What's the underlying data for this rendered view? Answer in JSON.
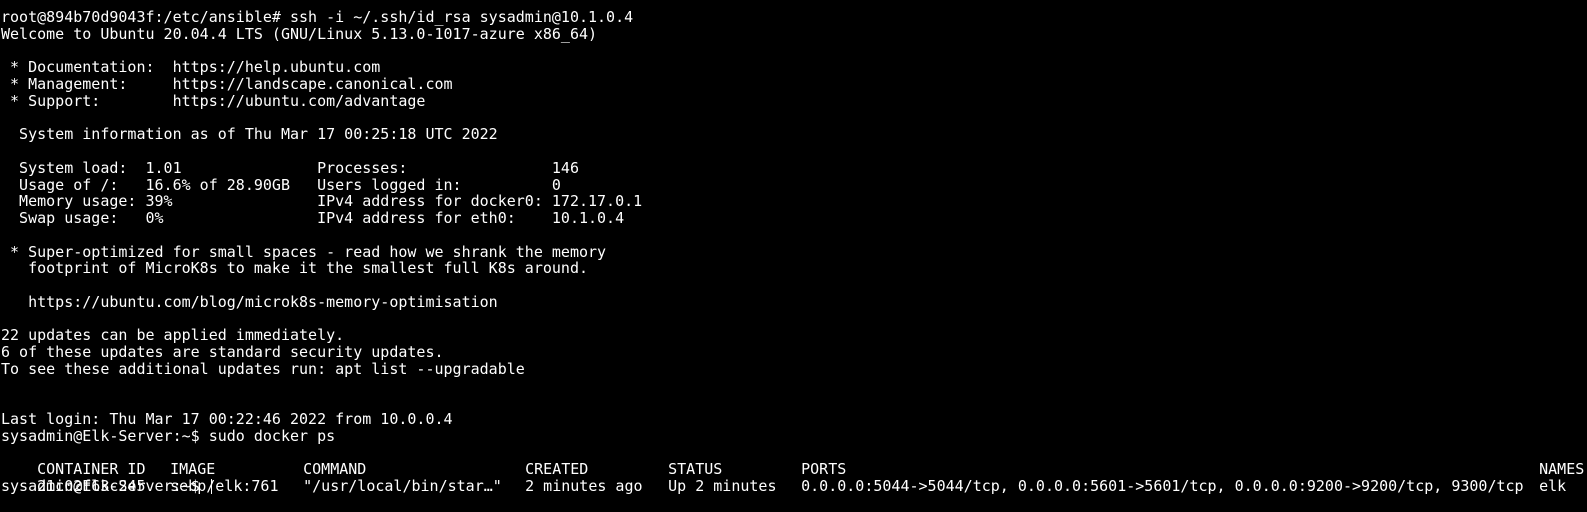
{
  "terminal": {
    "background": "#000000",
    "foreground": "#ffffff",
    "lines": [
      "root@894b70d9043f:/etc/ansible# ssh -i ~/.ssh/id_rsa sysadmin@10.1.0.4",
      "Welcome to Ubuntu 20.04.4 LTS (GNU/Linux 5.13.0-1017-azure x86_64)",
      "",
      " * Documentation:  https://help.ubuntu.com",
      " * Management:     https://landscape.canonical.com",
      " * Support:        https://ubuntu.com/advantage",
      "",
      "  System information as of Thu Mar 17 00:25:18 UTC 2022",
      "",
      "  System load:  1.01               Processes:                146",
      "  Usage of /:   16.6% of 28.90GB   Users logged in:          0",
      "  Memory usage: 39%                IPv4 address for docker0: 172.17.0.1",
      "  Swap usage:   0%                 IPv4 address for eth0:    10.1.0.4",
      "",
      " * Super-optimized for small spaces - read how we shrank the memory",
      "   footprint of MicroK8s to make it the smallest full K8s around.",
      "",
      "   https://ubuntu.com/blog/microk8s-memory-optimisation",
      "",
      "22 updates can be applied immediately.",
      "6 of these updates are standard security updates.",
      "To see these additional updates run: apt list --upgradable",
      "",
      "",
      "Last login: Thu Mar 17 00:22:46 2022 from 10.0.0.4",
      "sysadmin@Elk-Server:~$ sudo docker ps"
    ],
    "docker_table": {
      "headers": [
        "CONTAINER ID",
        "IMAGE",
        "COMMAND",
        "CREATED",
        "STATUS",
        "PORTS",
        "NAMES"
      ],
      "rows": [
        [
          "21c02f63c245",
          "sebp/elk:761",
          "\"/usr/local/bin/star…\"",
          "2 minutes ago",
          "Up 2 minutes",
          "0.0.0.0:5044->5044/tcp, 0.0.0.0:5601->5601/tcp, 0.0.0.0:9200->9200/tcp, 9300/tcp",
          "elk"
        ]
      ]
    },
    "prompt": "sysadmin@Elk-Server:~$ "
  }
}
